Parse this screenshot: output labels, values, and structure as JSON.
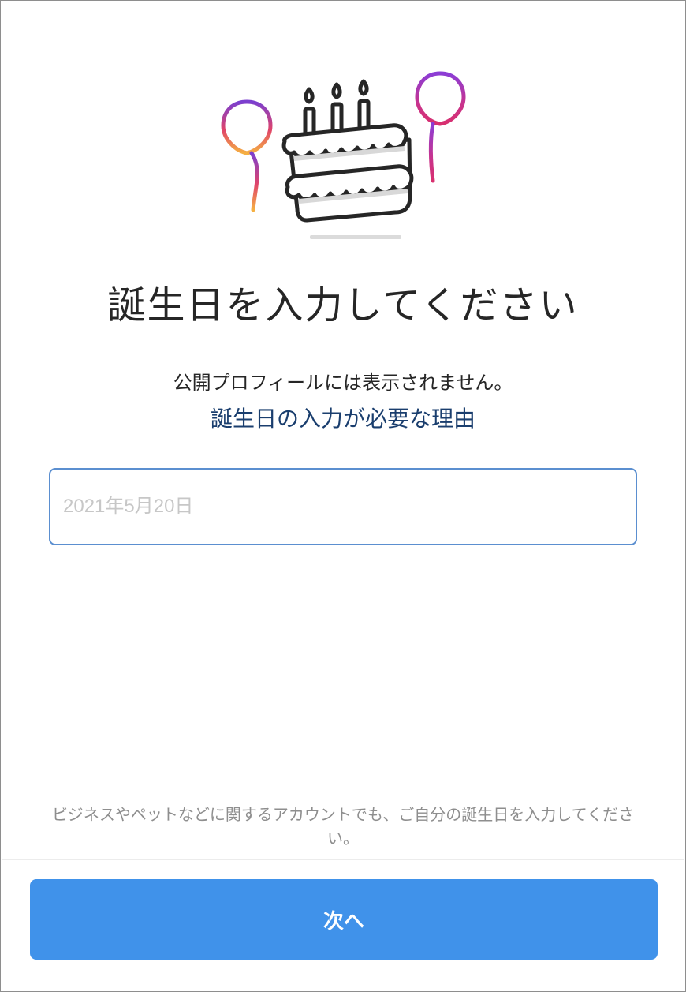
{
  "illustration": {
    "icon": "birthday-cake-with-balloons-icon",
    "colors": {
      "balloon_left_start": "#7b3fcf",
      "balloon_left_end": "#f5a623",
      "balloon_right_start": "#8b3dd6",
      "balloon_right_end": "#d8306f",
      "cake_stroke": "#262626"
    }
  },
  "header": {
    "title": "誕生日を入力してください",
    "subtitle": "公開プロフィールには表示されません。",
    "why_link": "誕生日の入力が必要な理由"
  },
  "birthday_field": {
    "value": "",
    "placeholder": "2021年5月20日"
  },
  "footer": {
    "note": "ビジネスやペットなどに関するアカウントでも、ご自分の誕生日を入力してください。",
    "next_button": "次へ"
  },
  "colors": {
    "accent": "#4092ea",
    "link": "#1a3e6e",
    "input_border": "#5b8fd0"
  }
}
